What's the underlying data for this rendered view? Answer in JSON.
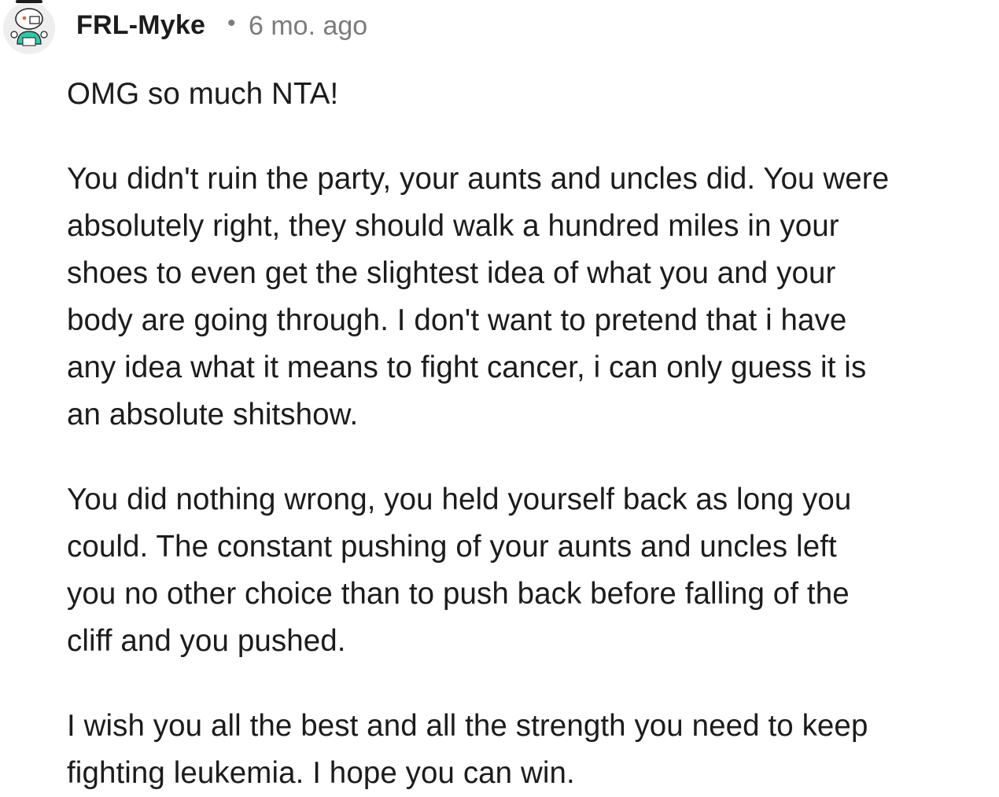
{
  "comment": {
    "author": "FRL-Myke",
    "separator": "•",
    "timestamp": "6 mo. ago",
    "avatar_icon": "snoo-avatar-icon",
    "paragraphs": [
      {
        "lines": [
          "OMG so much NTA!"
        ]
      },
      {
        "lines": [
          "You didn't ruin the party, your aunts and uncles did. You were",
          "absolutely right, they should walk a hundred miles in your",
          "shoes to even get the slightest idea of what you and your",
          "body are going through. I don't want to pretend that i have",
          "any idea what it means to fight cancer, i can only guess it is",
          "an absolute shitshow."
        ]
      },
      {
        "lines": [
          "You did nothing wrong, you held yourself back as long you",
          "could. The constant pushing of your aunts and uncles left",
          "you no other choice than to push back before falling of the",
          "cliff and you pushed."
        ]
      },
      {
        "lines": [
          "I wish you all the best and all the strength you need to keep",
          "fighting leukemia. I hope you can win."
        ]
      }
    ]
  },
  "colors": {
    "text": "#1c1c1c",
    "meta": "#7c7c7c",
    "avatar_shirt": "#2ec9a6",
    "avatar_bg": "#eeeeee"
  }
}
